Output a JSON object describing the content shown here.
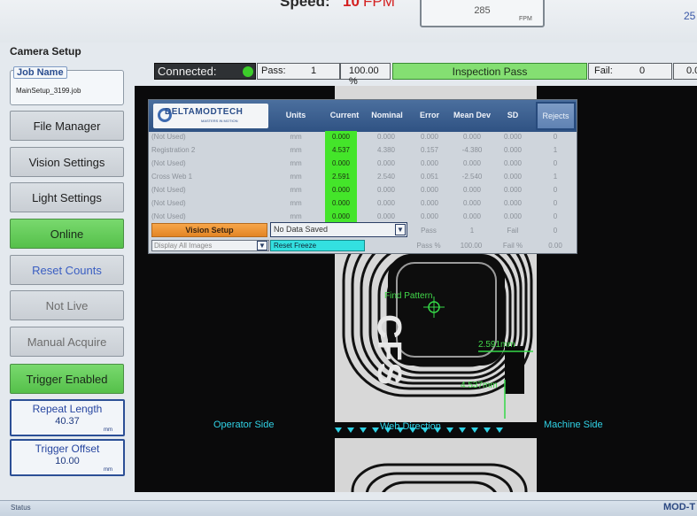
{
  "top": {
    "speed_label": "Speed:",
    "speed_value": "10",
    "speed_unit": "FPM",
    "fpm_box_value": "285",
    "fpm_box_unit": "FPM",
    "right_value": "25"
  },
  "left_panel": {
    "section_title": "Camera Setup",
    "job": {
      "label": "Job Name",
      "file": "MainSetup_3199.job"
    },
    "buttons": [
      {
        "label": "File Manager"
      },
      {
        "label": "Vision Settings"
      },
      {
        "label": "Light Settings"
      },
      {
        "label": "Online"
      },
      {
        "label": "Reset Counts"
      },
      {
        "label": "Not Live"
      },
      {
        "label": "Manual Acquire"
      },
      {
        "label": "Trigger Enabled"
      }
    ],
    "repeat_length": {
      "label": "Repeat Length",
      "value": "40.37",
      "unit": "mm"
    },
    "trigger_offset": {
      "label": "Trigger Offset",
      "value": "10.00",
      "unit": "mm"
    }
  },
  "status_row": {
    "connected_label": "Connected:",
    "pass_label": "Pass:",
    "pass_count": "1",
    "pass_percent": "100.00 %",
    "inspection_status": "Inspection Pass",
    "fail_label": "Fail:",
    "fail_count": "0",
    "fail_percent": "0.0"
  },
  "panel": {
    "logo_text": "DELTAMODTECH",
    "logo_tagline": "MASTERS IN MOTION",
    "columns": [
      "Units",
      "Current",
      "Nominal",
      "Error",
      "Mean Dev",
      "SD",
      "Rejects"
    ],
    "rows": [
      {
        "name": "(Not Used)",
        "units": "mm",
        "current": "0.000",
        "nominal": "0.000",
        "error": "0.000",
        "mean_dev": "0.000",
        "sd": "0.000",
        "rejects": "0"
      },
      {
        "name": "Registration 2",
        "units": "mm",
        "current": "4.537",
        "nominal": "4.380",
        "error": "0.157",
        "mean_dev": "-4.380",
        "sd": "0.000",
        "rejects": "1"
      },
      {
        "name": "(Not Used)",
        "units": "mm",
        "current": "0.000",
        "nominal": "0.000",
        "error": "0.000",
        "mean_dev": "0.000",
        "sd": "0.000",
        "rejects": "0"
      },
      {
        "name": "Cross Web 1",
        "units": "mm",
        "current": "2.591",
        "nominal": "2.540",
        "error": "0.051",
        "mean_dev": "-2.540",
        "sd": "0.000",
        "rejects": "1"
      },
      {
        "name": "(Not Used)",
        "units": "mm",
        "current": "0.000",
        "nominal": "0.000",
        "error": "0.000",
        "mean_dev": "0.000",
        "sd": "0.000",
        "rejects": "0"
      },
      {
        "name": "(Not Used)",
        "units": "mm",
        "current": "0.000",
        "nominal": "0.000",
        "error": "0.000",
        "mean_dev": "0.000",
        "sd": "0.000",
        "rejects": "0"
      },
      {
        "name": "(Not Used)",
        "units": "mm",
        "current": "0.000",
        "nominal": "0.000",
        "error": "0.000",
        "mean_dev": "0.000",
        "sd": "0.000",
        "rejects": "0"
      }
    ],
    "vision_setup_label": "Vision Setup",
    "no_data_label": "No Data Saved",
    "display_label": "Display All Images",
    "reset_freeze_label": "Reset Freeze",
    "stats": {
      "pass_label": "Pass",
      "pass_value": "1",
      "fail_label": "Fail",
      "fail_value": "0",
      "pass_pct_label": "Pass %",
      "pass_pct_value": "100.00",
      "fail_pct_label": "Fail %",
      "fail_pct_value": "0.00"
    }
  },
  "viewport": {
    "find_pattern": "Find Pattern",
    "measure_1": "2.591mm",
    "measure_2": "4.537mm",
    "operator_side": "Operator Side",
    "web_direction": "Web Direction",
    "machine_side": "Machine Side",
    "part_text": "CFS"
  },
  "status_bar": {
    "label": "Status",
    "mod_label": "MOD-T"
  },
  "colors": {
    "accent_green": "#55c04a",
    "current_cell_green": "#44e52a",
    "overlay_cyan": "#30d2e6",
    "speed_red": "#d42020",
    "header_blue": "#2f5283"
  }
}
